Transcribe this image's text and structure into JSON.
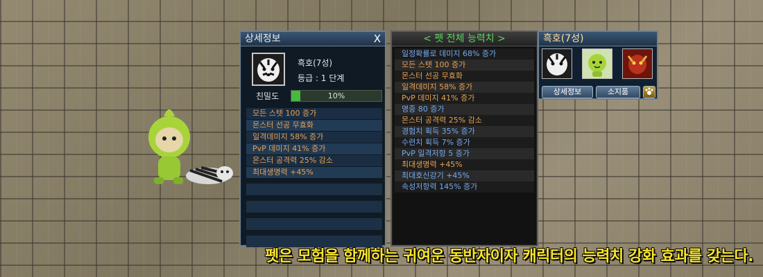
{
  "detail_panel": {
    "title": "상세정보",
    "close": "X",
    "pet_name": "흑호(7성)",
    "pet_grade": "등급 : 1 단계",
    "intimacy_label": "친밀도",
    "intimacy_value": "10%",
    "intimacy_fraction": 0.1,
    "stats": [
      "모든 스텟 100 증가",
      "몬스터 선공 무효화",
      "일격데미지 58% 증가",
      "PvP 데미지 41% 증가",
      "몬스터 공격력 25% 감소",
      "최대생명력 +45%"
    ]
  },
  "total_panel": {
    "title": "< 펫 전체 능력치 >",
    "stats": [
      {
        "text": "일정확률로 데미지 68% 증가",
        "color": "#74a9ef"
      },
      {
        "text": "모든 스텟 100 증가",
        "color": "#e6a255"
      },
      {
        "text": "몬스터 선공 무효화",
        "color": "#e6a255"
      },
      {
        "text": "일격데미지 58% 증가",
        "color": "#e6a255"
      },
      {
        "text": "PvP 데미지 41% 증가",
        "color": "#e6a255"
      },
      {
        "text": "명중 80 증가",
        "color": "#74a9ef"
      },
      {
        "text": "몬스터 공격력 25% 감소",
        "color": "#e6a255"
      },
      {
        "text": "경험치 획득 35% 증가",
        "color": "#74a9ef"
      },
      {
        "text": "수련치 획득 7% 증가",
        "color": "#74a9ef"
      },
      {
        "text": "PvP 일격저항 5 증가",
        "color": "#74a9ef"
      },
      {
        "text": "최대생명력 +45%",
        "color": "#e6a255"
      },
      {
        "text": "최대호신강기 +45%",
        "color": "#74a9ef"
      },
      {
        "text": "속성저항력 145% 증가",
        "color": "#74a9ef"
      }
    ]
  },
  "pet_list": {
    "title": "흑호(7성)",
    "detail_button": "상세정보",
    "inventory_button": "소지품",
    "paw_icon": "paw-icon"
  },
  "caption": "펫은 모험을 함께하는 귀여운 동반자이자 캐릭터의 능력치 강화 효과를 갖는다."
}
